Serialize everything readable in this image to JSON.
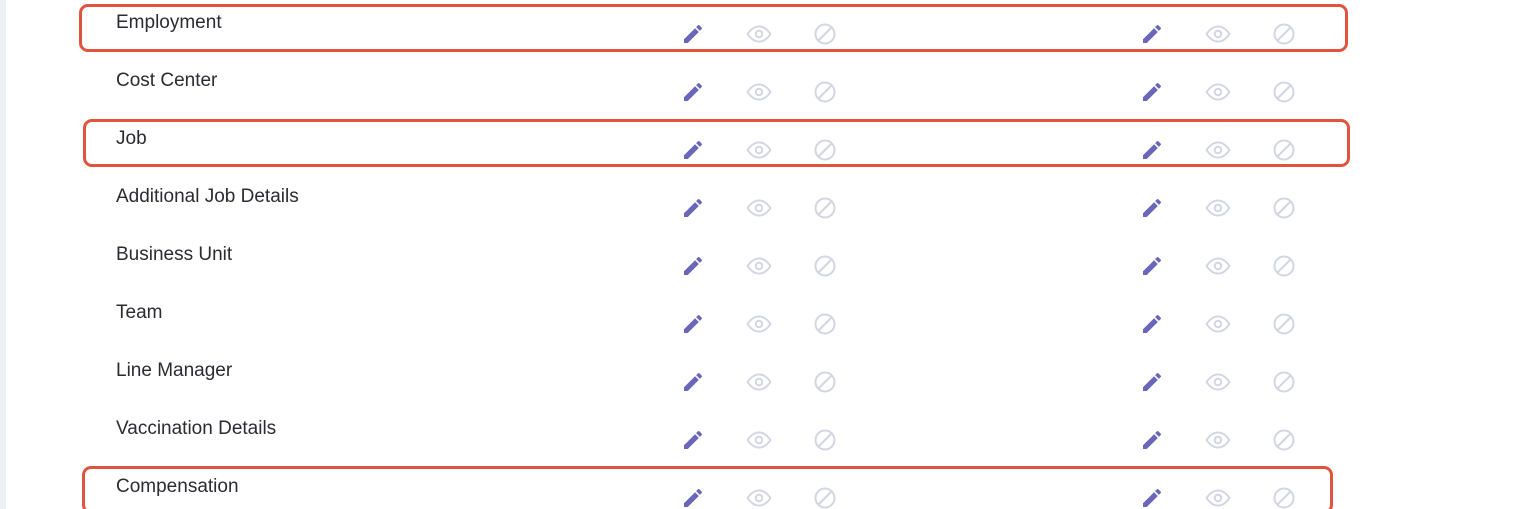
{
  "permissions": {
    "rows": [
      {
        "label": "Employment"
      },
      {
        "label": "Cost Center"
      },
      {
        "label": "Job"
      },
      {
        "label": "Additional Job Details"
      },
      {
        "label": "Business Unit"
      },
      {
        "label": "Team"
      },
      {
        "label": "Line Manager"
      },
      {
        "label": "Vaccination Details"
      },
      {
        "label": "Compensation"
      }
    ],
    "highlighted_rows": [
      "Employment",
      "Job",
      "Compensation"
    ]
  },
  "icons": {
    "edit": "pencil-icon",
    "view": "eye-icon",
    "no_access": "no-access-icon"
  },
  "colors": {
    "edit_icon": "#6a66b8",
    "inactive_icon": "#d3d6e2",
    "highlight_border": "#e0533d",
    "label_text": "#2b2b33",
    "left_rail": "#eef0f6"
  }
}
